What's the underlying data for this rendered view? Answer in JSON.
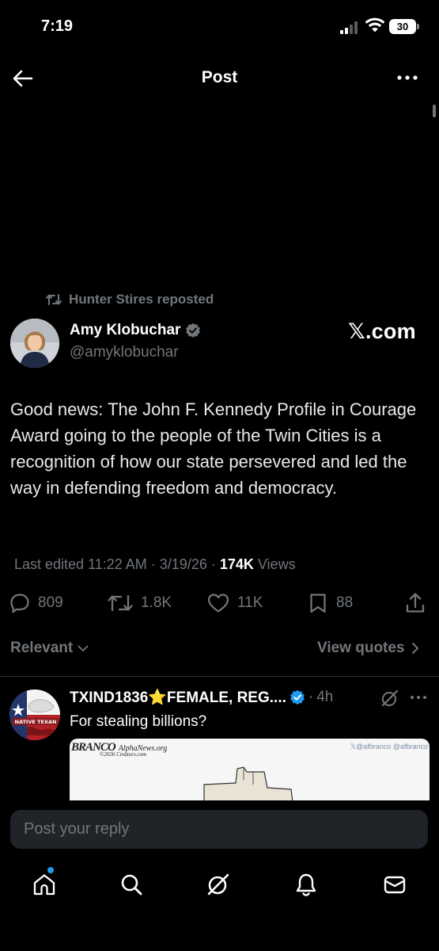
{
  "status_bar": {
    "time": "7:19",
    "battery": "30"
  },
  "header": {
    "title": "Post"
  },
  "repost": {
    "text": "Hunter Stires reposted"
  },
  "author": {
    "name": "Amy Klobuchar",
    "handle": "@amyklobuchar",
    "verified": true
  },
  "watermark": {
    "logo": "𝕏.com"
  },
  "post": {
    "text": "Good news: The John F. Kennedy Profile in Courage Award going to the people of the Twin Cities is a recognition of how our state persevered and led the way in defending freedom and democracy.",
    "edited_prefix": "Last edited 11:22 AM · 3/19/26 · ",
    "views_count": "174K",
    "views_label": " Views"
  },
  "actions": {
    "replies": "809",
    "reposts": "1.8K",
    "likes": "11K",
    "bookmarks": "88"
  },
  "sort": {
    "label": "Relevant",
    "view_quotes": "View quotes"
  },
  "reply": {
    "name": "TXIND1836⭐FEMALE, REG....",
    "time": "4h",
    "text": "For stealing billions?",
    "avatar_text": "NATIVE TEXAN",
    "media_watermark_left_name": "BRANCO",
    "media_watermark_left_site": "AlphaNews.org",
    "media_watermark_left_sub": "©2026 Creators.com",
    "media_watermark_right": "𝕏@afbranco  @afbranco"
  },
  "composer": {
    "placeholder": "Post your reply"
  },
  "colors": {
    "background": "#000000",
    "accent": "#1d9bf0",
    "muted": "#71767b",
    "text": "#e7e9ea"
  }
}
